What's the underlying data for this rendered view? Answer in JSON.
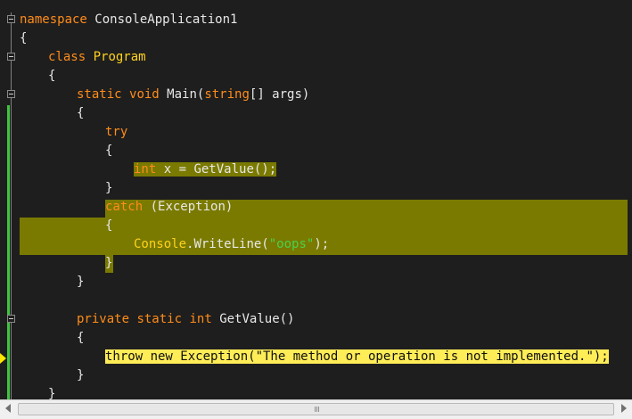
{
  "code": {
    "l1_kw": "namespace",
    "l1_name": " ConsoleApplication1",
    "l2": "{",
    "l3_kw": "class",
    "l3_sp": " ",
    "l3_name": "Program",
    "l4": "{",
    "l5_kw1": "static",
    "l5_sp1": " ",
    "l5_kw2": "void",
    "l5_rest1": " Main(",
    "l5_kw3": "string",
    "l5_rest2": "[] args)",
    "l6": "{",
    "l7_kw": "try",
    "l8": "{",
    "l9_kw": "int",
    "l9_rest": " x = GetValue();",
    "l10": "}",
    "l11_kw": "catch",
    "l11_rest": " (Exception)",
    "l12": "{",
    "l13_ty": "Console",
    "l13_rest1": ".WriteLine(",
    "l13_str": "\"oops\"",
    "l13_rest2": ");",
    "l14": "}",
    "l15": "}",
    "l17_kw1": "private",
    "l17_sp1": " ",
    "l17_kw2": "static",
    "l17_sp2": " ",
    "l17_kw3": "int",
    "l17_rest": " GetValue()",
    "l18": "{",
    "l19": "throw new Exception(\"The method or operation is not implemented.\");",
    "l20": "}",
    "l21": "}"
  },
  "colors": {
    "keyword": "#ff8c1a",
    "type": "#ffd21e",
    "string": "#4ad14a",
    "highlight": "#7a7a00",
    "current_statement": "#ffed57"
  },
  "icons": {
    "fold": "collapse-box-icon",
    "execution": "current-statement-arrow-icon"
  }
}
